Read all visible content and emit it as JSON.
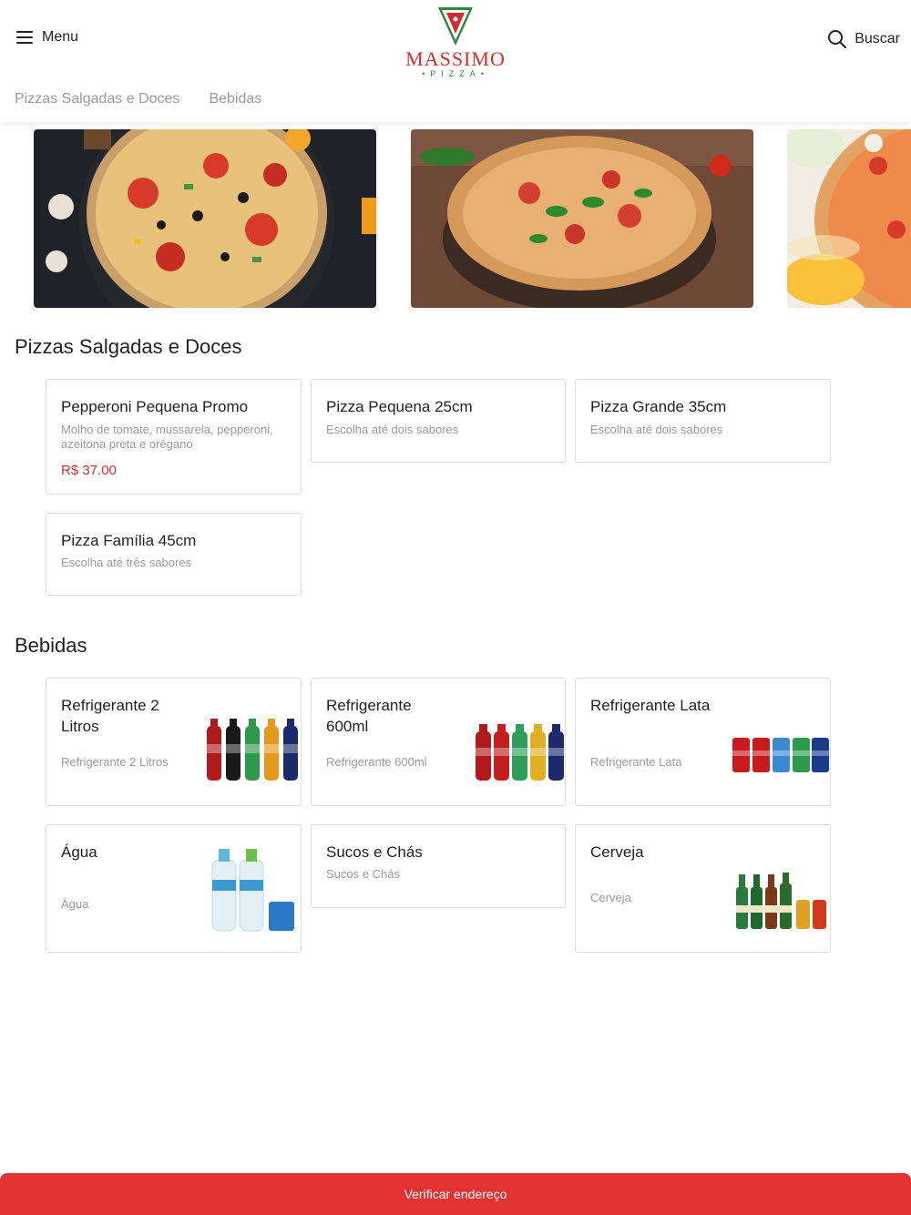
{
  "header": {
    "menu_label": "Menu",
    "search_label": "Buscar",
    "logo_word": "MASSIMO",
    "logo_sub": "•PIZZA•"
  },
  "tabs": [
    "Pizzas Salgadas e Doces",
    "Bebidas"
  ],
  "sections": {
    "pizzas": {
      "title": "Pizzas Salgadas e Doces",
      "items": [
        {
          "title": "Pepperoni Pequena Promo",
          "desc": "Molho de tomate, mussarela, pepperoni, azeitona preta e orégano",
          "price": "R$ 37.00"
        },
        {
          "title": "Pizza Pequena 25cm",
          "desc": "Escolha até dois sabores"
        },
        {
          "title": "Pizza Grande 35cm",
          "desc": "Escolha até dois sabores"
        },
        {
          "title": "Pizza Família 45cm",
          "desc": "Escolha até três sabores"
        }
      ]
    },
    "bebidas": {
      "title": "Bebidas",
      "items": [
        {
          "title": "Refrigerante 2 Litros",
          "desc": "Refrigerante 2 Litros"
        },
        {
          "title": "Refrigerante 600ml",
          "desc": "Refrigerante 600ml"
        },
        {
          "title": "Refrigerante Lata",
          "desc": "Refrigerante Lata"
        },
        {
          "title": "Água",
          "desc": "Água"
        },
        {
          "title": "Sucos e Chás",
          "desc": "Sucos e Chás"
        },
        {
          "title": "Cerveja",
          "desc": "Cerveja"
        }
      ]
    }
  },
  "cta": {
    "label": "Verificar endereço"
  },
  "colors": {
    "brand_red": "#e23232",
    "logo_green": "#2a8a3e",
    "price_red": "#d62c2c"
  }
}
